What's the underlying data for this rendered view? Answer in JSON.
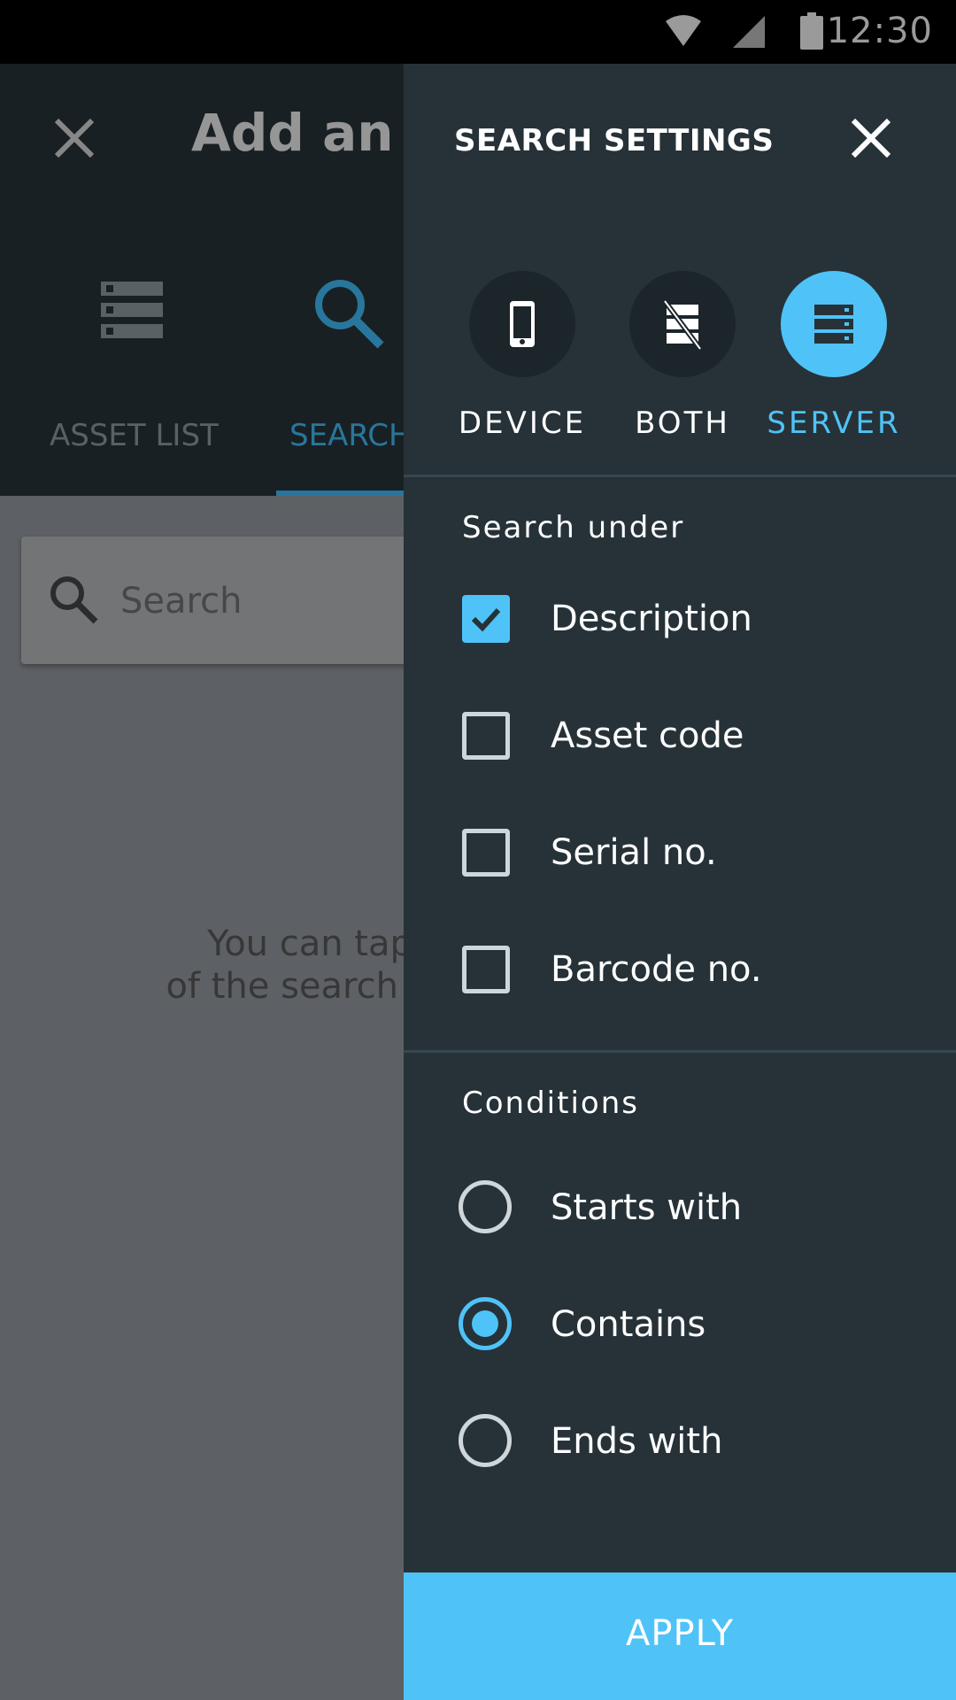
{
  "status_bar": {
    "time": "12:30",
    "icons": [
      "wifi-icon",
      "signal-icon",
      "battery-icon"
    ]
  },
  "background_app": {
    "title": "Add an as",
    "tabs": [
      {
        "label": "ASSET LIST",
        "icon": "list-icon",
        "active": false
      },
      {
        "label": "SEARCH",
        "icon": "search-icon",
        "active": true
      }
    ],
    "search": {
      "placeholder": "Search"
    },
    "hint_line1": "You can tap",
    "hint_line2": "of the search ba"
  },
  "drawer": {
    "title": "SEARCH SETTINGS",
    "modes": [
      {
        "label": "DEVICE",
        "icon": "phone-icon",
        "selected": false
      },
      {
        "label": "BOTH",
        "icon": "server-off-icon",
        "selected": false
      },
      {
        "label": "SERVER",
        "icon": "server-icon",
        "selected": true
      }
    ],
    "search_under": {
      "title": "Search under",
      "options": [
        {
          "label": "Description",
          "checked": true
        },
        {
          "label": "Asset code",
          "checked": false
        },
        {
          "label": "Serial no.",
          "checked": false
        },
        {
          "label": "Barcode no.",
          "checked": false
        }
      ]
    },
    "conditions": {
      "title": "Conditions",
      "options": [
        {
          "label": "Starts with",
          "selected": false
        },
        {
          "label": "Contains",
          "selected": true
        },
        {
          "label": "Ends with",
          "selected": false
        }
      ]
    },
    "apply_label": "APPLY"
  },
  "colors": {
    "accent": "#4fc3f7",
    "drawer_bg": "#263238",
    "header_bg": "#263238"
  }
}
